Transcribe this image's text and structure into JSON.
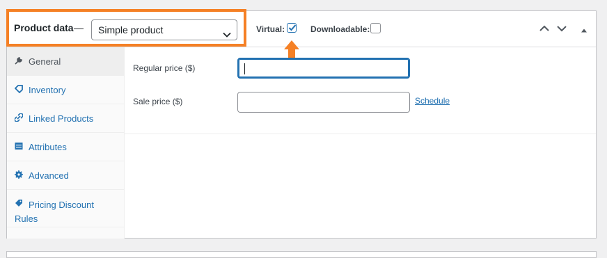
{
  "header": {
    "title": "Product data",
    "dash": "—",
    "product_type": "Simple product",
    "virtual_label": "Virtual:",
    "virtual_checked": true,
    "downloadable_label": "Downloadable:",
    "downloadable_checked": false
  },
  "tabs": [
    {
      "label": "General",
      "icon": "wrench-icon",
      "active": true
    },
    {
      "label": "Inventory",
      "icon": "tag-icon",
      "active": false
    },
    {
      "label": "Linked Products",
      "icon": "link-icon",
      "active": false
    },
    {
      "label": "Attributes",
      "icon": "list-icon",
      "active": false
    },
    {
      "label": "Advanced",
      "icon": "gear-icon",
      "active": false
    },
    {
      "label": "Pricing Discount Rules",
      "icon": "price-tag-icon",
      "active": false
    }
  ],
  "general": {
    "regular_price_label": "Regular price ($)",
    "regular_price_value": "",
    "sale_price_label": "Sale price ($)",
    "sale_price_value": "",
    "schedule_link": "Schedule"
  },
  "colors": {
    "highlight": "#f58025",
    "accent": "#2271b1"
  }
}
